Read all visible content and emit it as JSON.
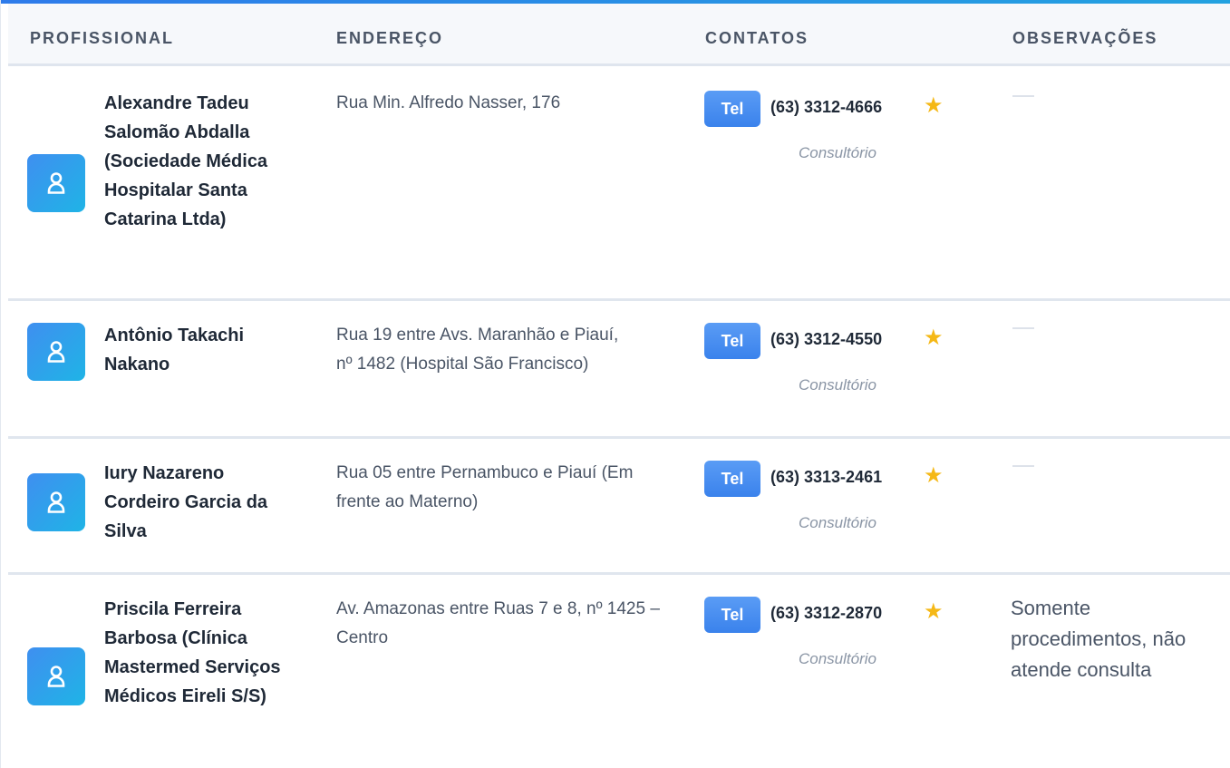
{
  "table": {
    "headers": {
      "professional": "PROFISSIONAL",
      "address": "ENDEREÇO",
      "contacts": "CONTATOS",
      "notes": "OBSERVAÇÕES"
    },
    "rows": [
      {
        "name": "Alexandre Tadeu Salomão Abdalla (Sociedade Médica Hospitalar Santa Catarina Ltda)",
        "address": "Rua Min. Alfredo Nasser, 176",
        "tel_label": "Tel",
        "phone": "(63) 3312-4666",
        "location": "Consultório",
        "notes": ""
      },
      {
        "name": "Antônio Takachi Nakano",
        "address": "Rua 19 entre Avs. Maranhão e Piauí, nº 1482 (Hospital São Francisco)",
        "tel_label": "Tel",
        "phone": "(63) 3312-4550",
        "location": "Consultório",
        "notes": ""
      },
      {
        "name": "Iury Nazareno Cordeiro Garcia da Silva",
        "address": "Rua 05 entre Pernambuco e Piauí (Em frente ao Materno)",
        "tel_label": "Tel",
        "phone": "(63) 3313-2461",
        "location": "Consultório",
        "notes": ""
      },
      {
        "name": "Priscila Ferreira Barbosa (Clínica Mastermed Serviços Médicos Eireli S/S)",
        "address": "Av. Amazonas entre Ruas 7 e 8, nº 1425 – Centro",
        "tel_label": "Tel",
        "phone": "(63) 3312-2870",
        "location": "Consultório",
        "notes": "Somente procedimentos, não atende consulta"
      }
    ]
  },
  "icons": {
    "avatar": "user-icon",
    "favorite": "star-icon",
    "empty_note": "dash"
  },
  "colors": {
    "accent": "#3a82ec",
    "star": "#f5b816",
    "header_bg": "#f6f8fb"
  }
}
